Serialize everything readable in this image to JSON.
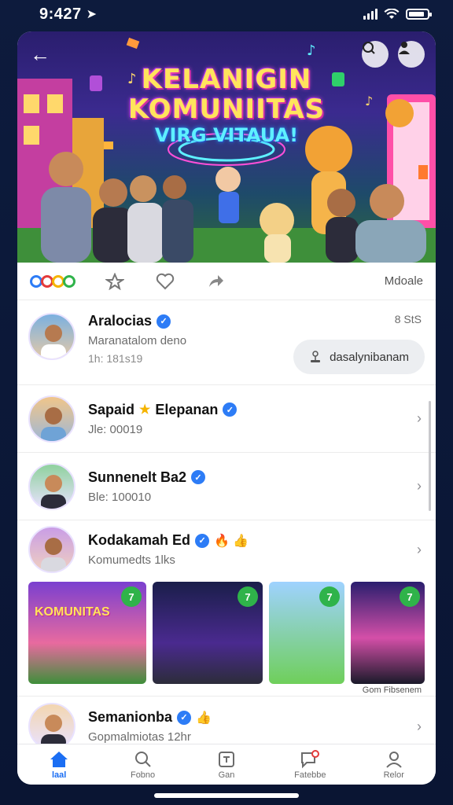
{
  "status_bar": {
    "time": "9:427",
    "battery_level": 0.85
  },
  "hero": {
    "title_line1": "KELANIGIN",
    "title_line2": "KOMUNIITAS",
    "subtitle": "VIRG VITAUA!"
  },
  "actions": {
    "more_label": "Mdoale",
    "reaction_colors": [
      "#2d7cf6",
      "#e43b3b",
      "#f5b400",
      "#2fb34a"
    ]
  },
  "rows": [
    {
      "name": "Aralocias",
      "sub": "Maranatalom deno",
      "meta": "1h: 181s19",
      "time": "8 StS",
      "button_label": "dasalynibanam"
    },
    {
      "name": "Sapaid",
      "emoji": "★",
      "name_suffix": "Elepanan",
      "sub": "Jle: 00019"
    },
    {
      "name": "Sunnenelt Ba2",
      "sub": "Ble: 100010"
    },
    {
      "name": "Kodakamah Ed",
      "emoji": "🔥 👍",
      "sub": "Komumedts 1lks"
    }
  ],
  "thumbs": {
    "items": [
      {
        "title": "KOMUNITAS",
        "badge": "7"
      },
      {
        "badge": "7"
      },
      {
        "badge": "7"
      },
      {
        "badge": "7"
      }
    ],
    "caption": "Gom Fibsenem"
  },
  "last_row": {
    "name": "Semanionba",
    "emoji": "👍",
    "sub": "Gopmalmiotas 12hr"
  },
  "tabbar": {
    "tabs": [
      {
        "label": "laal",
        "icon": "home-icon",
        "active": true
      },
      {
        "label": "Fobno",
        "icon": "search-icon",
        "active": false
      },
      {
        "label": "Gan",
        "icon": "box-icon",
        "active": false
      },
      {
        "label": "Fatebbe",
        "icon": "chat-icon",
        "active": false
      },
      {
        "label": "Relor",
        "icon": "profile-icon",
        "active": false
      }
    ],
    "accent_color": "#1b6ef3"
  }
}
